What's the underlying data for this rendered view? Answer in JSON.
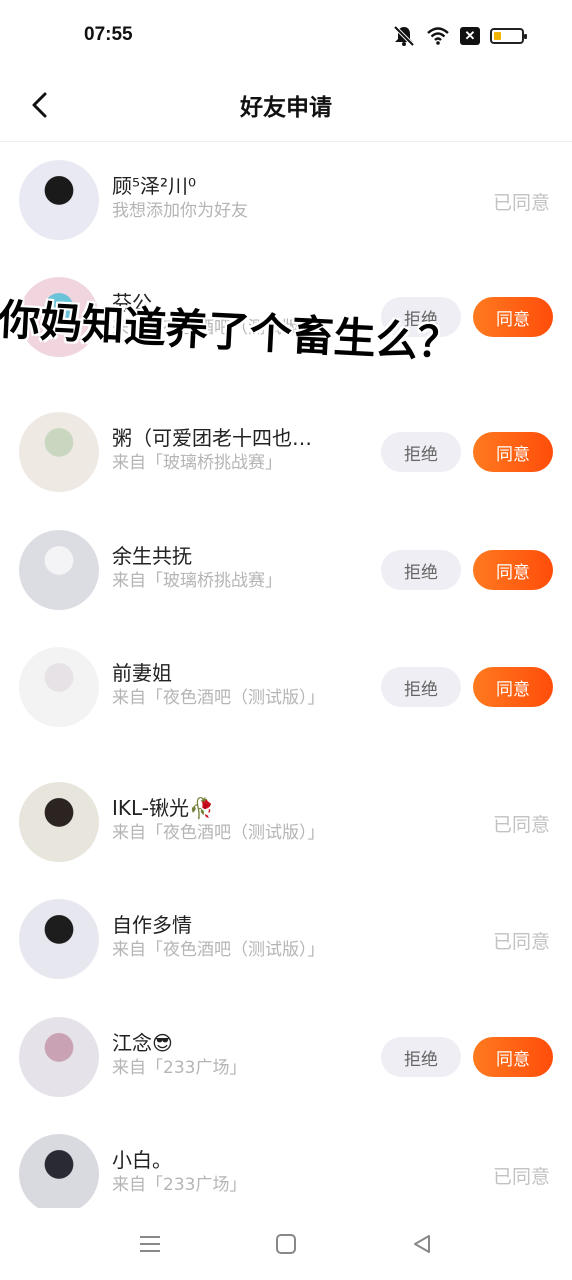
{
  "status": {
    "time": "07:55",
    "battery_level": 0.25
  },
  "header": {
    "title": "好友申请"
  },
  "buttons": {
    "reject": "拒绝",
    "accept": "同意",
    "agreed": "已同意"
  },
  "caption": "你妈知道养了个畜生么？",
  "requests": [
    {
      "name": "顾⁵泽²川⁰",
      "source": "我想添加你为好友",
      "state": "agreed",
      "avatar_colors": [
        "#e9e9f3",
        "#1a1a1a"
      ]
    },
    {
      "name": "芬公",
      "source": "来自「夜色酒吧（测试版）」",
      "state": "pending",
      "avatar_colors": [
        "#f1d5de",
        "#6ac3d8"
      ]
    },
    {
      "name": "粥（可爱团老十四也…",
      "source": "来自「玻璃桥挑战赛」",
      "state": "pending",
      "avatar_colors": [
        "#efe9e4",
        "#c9d7c1"
      ]
    },
    {
      "name": "余生共抚",
      "source": "来自「玻璃桥挑战赛」",
      "state": "pending",
      "avatar_colors": [
        "#dcdde3",
        "#f4f4f6"
      ]
    },
    {
      "name": "前妻姐",
      "source": "来自「夜色酒吧（测试版）」",
      "state": "pending",
      "avatar_colors": [
        "#f3f3f3",
        "#e6e2e6"
      ]
    },
    {
      "name": "IKL-锹光🥀",
      "source": "来自「夜色酒吧（测试版）」",
      "state": "agreed",
      "avatar_colors": [
        "#e8e5dc",
        "#2b2421"
      ]
    },
    {
      "name": "自作多情",
      "source": "来自「夜色酒吧（测试版）」",
      "state": "agreed",
      "avatar_colors": [
        "#e7e8ef",
        "#1d1d1d"
      ]
    },
    {
      "name": "江念😎",
      "source": "来自「233广场」",
      "state": "pending",
      "avatar_colors": [
        "#e6e2ea",
        "#c9a3b4"
      ]
    },
    {
      "name": "小白。",
      "source": "来自「233广场」",
      "state": "agreed",
      "avatar_colors": [
        "#d9d9e0",
        "#2a2a34"
      ]
    }
  ]
}
